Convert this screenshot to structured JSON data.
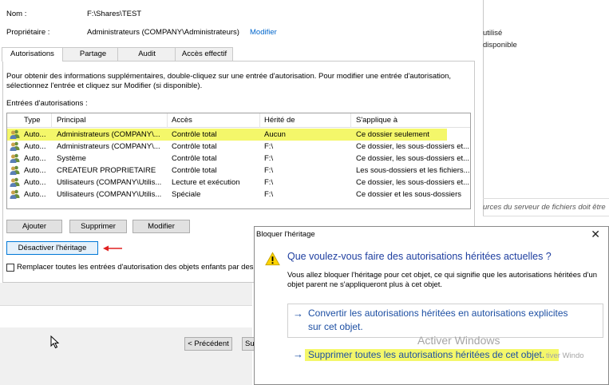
{
  "dialog": {
    "name_label": "Nom :",
    "name_value": "F:\\Shares\\TEST",
    "owner_label": "Propriétaire :",
    "owner_value": "Administrateurs (COMPANY\\Administrateurs)",
    "owner_change_link": "Modifier",
    "tabs": [
      "Autorisations",
      "Partage",
      "Audit",
      "Accès effectif"
    ],
    "info_text_1": "Pour obtenir des informations supplémentaires, double-cliquez sur une entrée d'autorisation. Pour modifier une entrée d'autorisation,",
    "info_text_2": "sélectionnez l'entrée et cliquez sur Modifier (si disponible).",
    "entries_label": "Entrées d'autorisations :",
    "columns": [
      "Type",
      "Principal",
      "Accès",
      "Hérité de",
      "S'applique à"
    ],
    "rows": [
      {
        "type": "Auto...",
        "principal": "Administrateurs (COMPANY\\...",
        "access": "Contrôle total",
        "inherited": "Aucun",
        "applies": "Ce dossier seulement"
      },
      {
        "type": "Auto...",
        "principal": "Administrateurs (COMPANY\\...",
        "access": "Contrôle total",
        "inherited": "F:\\",
        "applies": "Ce dossier, les sous-dossiers et..."
      },
      {
        "type": "Auto...",
        "principal": "Système",
        "access": "Contrôle total",
        "inherited": "F:\\",
        "applies": "Ce dossier, les sous-dossiers et..."
      },
      {
        "type": "Auto...",
        "principal": "CREATEUR PROPRIETAIRE",
        "access": "Contrôle total",
        "inherited": "F:\\",
        "applies": "Les sous-dossiers et les fichiers..."
      },
      {
        "type": "Auto...",
        "principal": "Utilisateurs (COMPANY\\Utilis...",
        "access": "Lecture et exécution",
        "inherited": "F:\\",
        "applies": "Ce dossier, les sous-dossiers et..."
      },
      {
        "type": "Auto...",
        "principal": "Utilisateurs (COMPANY\\Utilis...",
        "access": "Spéciale",
        "inherited": "F:\\",
        "applies": "Ce dossier et les sous-dossiers"
      }
    ],
    "btn_add": "Ajouter",
    "btn_remove": "Supprimer",
    "btn_edit": "Modifier",
    "btn_disable_inheritance": "Désactiver l'héritage",
    "replace_checkbox_label": "Remplacer toutes les entrées d'autorisation des objets enfants par des",
    "btn_previous": "< Précédent",
    "btn_next_partial": "Su"
  },
  "background": {
    "text_utilise": "utilisé",
    "text_disponible": "disponible",
    "text_server": "urces du serveur de fichiers doit être"
  },
  "popup": {
    "title": "Bloquer l'héritage",
    "question": "Que voulez-vous faire des autorisations héritées actuelles ?",
    "description": "Vous allez bloquer l'héritage pour cet objet, ce qui signifie que les autorisations héritées d'un objet parent ne s'appliqueront plus à cet objet.",
    "option_convert_line1": "Convertir les autorisations héritées en autorisations explicites",
    "option_convert_line2": "sur cet objet.",
    "option_remove": "Supprimer toutes les autorisations héritées de cet objet."
  },
  "watermark": {
    "line1": "Activer Windows",
    "line2": "tiver Windo"
  },
  "colors": {
    "highlight": "#f4f76a",
    "link": "#0066cc",
    "option_text": "#1d4fa3",
    "annotation_arrow": "#e02020"
  }
}
